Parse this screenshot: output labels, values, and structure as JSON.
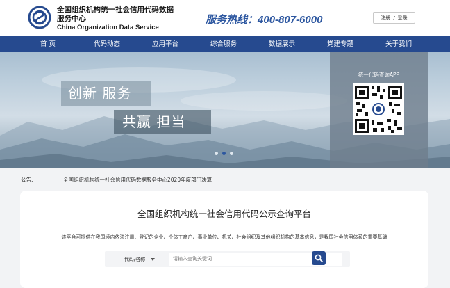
{
  "header": {
    "org_name_cn": "全国组织机构统一社会信用代码数据服务中心",
    "org_name_en": "China Organization Data Service",
    "hotline_label": "服务热线：",
    "hotline_number": "400-807-6000",
    "register": "注册",
    "separator": "/",
    "login": "登录"
  },
  "nav": {
    "items": [
      {
        "label": "首 页"
      },
      {
        "label": "代码动态"
      },
      {
        "label": "应用平台"
      },
      {
        "label": "综合服务"
      },
      {
        "label": "数据展示"
      },
      {
        "label": "党建专题"
      },
      {
        "label": "关于我们"
      }
    ]
  },
  "banner": {
    "slogan_line1": "创新 服务",
    "slogan_line2": "共赢 担当",
    "qr_label": "统一代码查询APP",
    "carousel_active_index": 1,
    "carousel_count": 3
  },
  "notice": {
    "label": "公告:",
    "text": "全国组织机构统一社会信用代码数据服务中心2020年度部门决算"
  },
  "query": {
    "title": "全国组织机构统一社会信用代码公示查询平台",
    "description": "该平台可提供在我国境内依法注册、登记的企业、个体工商户、事业单位、机关、社会组织及其他组织机构的基本信息，是我国社会信用体系的重要基础",
    "select_value": "代码/名称",
    "placeholder": "请输入查询关键词"
  },
  "colors": {
    "brand_blue": "#264a8f",
    "hotline_blue": "#2d57a0"
  }
}
